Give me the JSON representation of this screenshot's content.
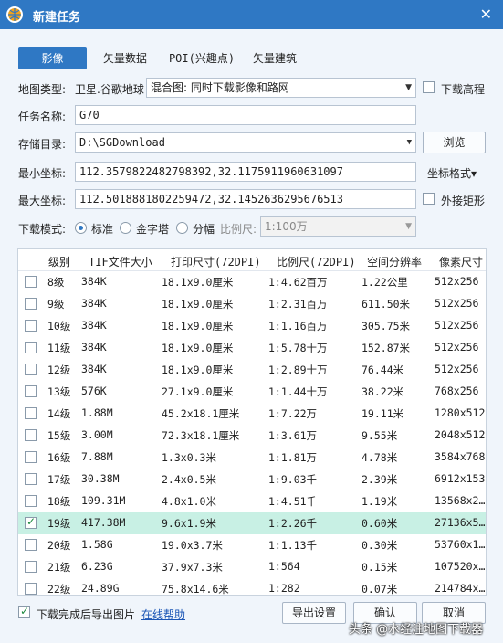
{
  "window": {
    "title": "新建任务",
    "close": "✕"
  },
  "tabs": [
    {
      "label": "影像",
      "active": true
    },
    {
      "label": "矢量数据",
      "active": false
    },
    {
      "label": "POI(兴趣点)",
      "active": false
    },
    {
      "label": "矢量建筑",
      "active": false
    }
  ],
  "form": {
    "map_type_label": "地图类型:",
    "map_source": "卫星.谷歌地球",
    "map_mode": "混合图: 同时下载影像和路网",
    "download_elevation_label": "下载高程",
    "task_name_label": "任务名称:",
    "task_name": "G70",
    "storage_label": "存储目录:",
    "storage_path": "D:\\SGDownload",
    "browse_label": "浏览",
    "min_coord_label": "最小坐标:",
    "min_coord": "112.3579822482798392,32.1175911960631097",
    "coord_format_label": "坐标格式▾",
    "max_coord_label": "最大坐标:",
    "max_coord": "112.5018881802259472,32.1452636295676513",
    "bounding_rect_label": "外接矩形",
    "download_mode_label": "下载模式:",
    "mode_standard": "标准",
    "mode_pyramid": "金字塔",
    "mode_tiled": "分幅",
    "scale_label": "比例尺:",
    "scale_value": "1:100万"
  },
  "table": {
    "headers": [
      "级别",
      "TIF文件大小",
      "打印尺寸(72DPI)",
      "比例尺(72DPI)",
      "空间分辨率",
      "像素尺寸"
    ],
    "rows": [
      {
        "checked": false,
        "level": "8级",
        "size": "384K",
        "print": "18.1x9.0厘米",
        "scale": "1:4.62百万",
        "res": "1.22公里",
        "pixels": "512x256"
      },
      {
        "checked": false,
        "level": "9级",
        "size": "384K",
        "print": "18.1x9.0厘米",
        "scale": "1:2.31百万",
        "res": "611.50米",
        "pixels": "512x256"
      },
      {
        "checked": false,
        "level": "10级",
        "size": "384K",
        "print": "18.1x9.0厘米",
        "scale": "1:1.16百万",
        "res": "305.75米",
        "pixels": "512x256"
      },
      {
        "checked": false,
        "level": "11级",
        "size": "384K",
        "print": "18.1x9.0厘米",
        "scale": "1:5.78十万",
        "res": "152.87米",
        "pixels": "512x256"
      },
      {
        "checked": false,
        "level": "12级",
        "size": "384K",
        "print": "18.1x9.0厘米",
        "scale": "1:2.89十万",
        "res": "76.44米",
        "pixels": "512x256"
      },
      {
        "checked": false,
        "level": "13级",
        "size": "576K",
        "print": "27.1x9.0厘米",
        "scale": "1:1.44十万",
        "res": "38.22米",
        "pixels": "768x256"
      },
      {
        "checked": false,
        "level": "14级",
        "size": "1.88M",
        "print": "45.2x18.1厘米",
        "scale": "1:7.22万",
        "res": "19.11米",
        "pixels": "1280x512"
      },
      {
        "checked": false,
        "level": "15级",
        "size": "3.00M",
        "print": "72.3x18.1厘米",
        "scale": "1:3.61万",
        "res": "9.55米",
        "pixels": "2048x512"
      },
      {
        "checked": false,
        "level": "16级",
        "size": "7.88M",
        "print": "1.3x0.3米",
        "scale": "1:1.81万",
        "res": "4.78米",
        "pixels": "3584x768"
      },
      {
        "checked": false,
        "level": "17级",
        "size": "30.38M",
        "print": "2.4x0.5米",
        "scale": "1:9.03千",
        "res": "2.39米",
        "pixels": "6912x1536"
      },
      {
        "checked": false,
        "level": "18级",
        "size": "109.31M",
        "print": "4.8x1.0米",
        "scale": "1:4.51千",
        "res": "1.19米",
        "pixels": "13568x2…"
      },
      {
        "checked": true,
        "level": "19级",
        "size": "417.38M",
        "print": "9.6x1.9米",
        "scale": "1:2.26千",
        "res": "0.60米",
        "pixels": "27136x5…",
        "selected": true
      },
      {
        "checked": false,
        "level": "20级",
        "size": "1.58G",
        "print": "19.0x3.7米",
        "scale": "1:1.13千",
        "res": "0.30米",
        "pixels": "53760x1…"
      },
      {
        "checked": false,
        "level": "21级",
        "size": "6.23G",
        "print": "37.9x7.3米",
        "scale": "1:564",
        "res": "0.15米",
        "pixels": "107520x…"
      },
      {
        "checked": false,
        "level": "22级",
        "size": "24.89G",
        "print": "75.8x14.6米",
        "scale": "1:282",
        "res": "0.07米",
        "pixels": "214784x…"
      }
    ]
  },
  "footer": {
    "export_after_label": "下载完成后导出图片",
    "help_link": "在线帮助",
    "export_settings": "导出设置",
    "ok": "确认",
    "cancel": "取消",
    "watermark": "头条 @水经注地图下载器"
  }
}
